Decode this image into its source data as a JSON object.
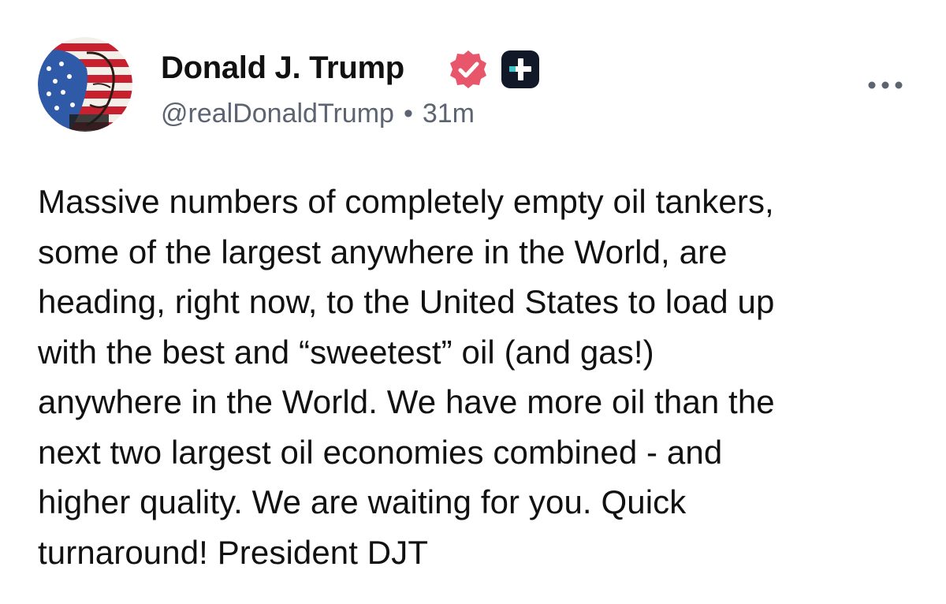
{
  "post": {
    "author": {
      "display_name": "Donald J. Trump",
      "handle": "@realDonaldTrump",
      "avatar_icon": "flag-portrait-avatar",
      "verified_icon": "verified-badge-icon",
      "plus_icon": "plus-badge-icon"
    },
    "separator": "•",
    "timestamp": "31m",
    "more_icon": "more-options-icon",
    "body_lines": [
      "Massive numbers of completely empty oil tankers,",
      "some of the largest anywhere in the World, are",
      "heading, right now, to the United States to load up",
      "with the best and “sweetest” oil (and gas!)",
      "anywhere in the World. We have more oil than the",
      "next two largest oil economies combined - and",
      "higher quality. We are waiting for you. Quick",
      "turnaround! President DJT"
    ]
  },
  "colors": {
    "text": "#111111",
    "secondary_text": "#5b6470",
    "verified_badge": "#e8566c",
    "plus_badge": "#111827",
    "plus_badge_accent": "#3ec6cc"
  }
}
